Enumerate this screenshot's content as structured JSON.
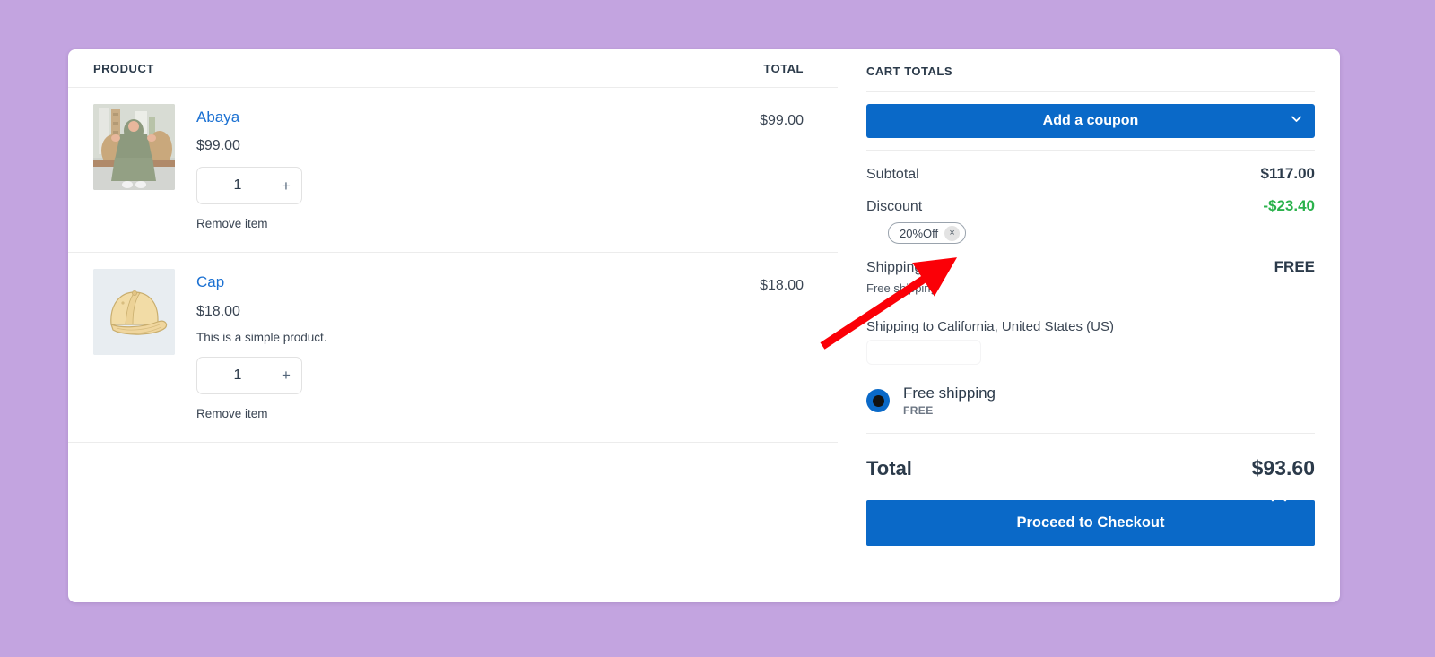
{
  "page": {
    "background_color": "#c3a4e0",
    "accent_color": "#0a69c8",
    "link_color": "#1a70d2",
    "discount_color": "#2bb24c"
  },
  "cart_table": {
    "headers": {
      "product": "PRODUCT",
      "total": "TOTAL"
    },
    "items": [
      {
        "name": "Abaya",
        "price": "$99.00",
        "description": "",
        "quantity": "1",
        "increase_label": "+",
        "remove_label": "Remove item",
        "line_total": "$99.00",
        "image": "abaya-photo"
      },
      {
        "name": "Cap",
        "price": "$18.00",
        "description": "This is a simple product.",
        "quantity": "1",
        "increase_label": "+",
        "remove_label": "Remove item",
        "line_total": "$18.00",
        "image": "cap-illustration"
      }
    ]
  },
  "cart_totals": {
    "title": "CART TOTALS",
    "coupon_button": "Add a coupon",
    "coupon_chevron_icon": "chevron-down-icon",
    "subtotal_label": "Subtotal",
    "subtotal_value": "$117.00",
    "discount_label": "Discount",
    "discount_value": "-$23.40",
    "coupon_chip": {
      "label": "20%Off",
      "remove_icon": "×"
    },
    "shipping_label": "Shipping",
    "shipping_value": "FREE",
    "shipping_note": "Free shipping",
    "shipping_address": "Shipping to California, United States (US)",
    "shipping_option": {
      "title": "Free shipping",
      "sub": "FREE",
      "selected": true
    },
    "total_label": "Total",
    "total_value": "$93.60",
    "checkout_button": "Proceed to Checkout",
    "close_icon": "chevron-up-icon"
  },
  "annotation": {
    "type": "arrow",
    "color": "#fb0007",
    "points_at": "coupon-chip"
  }
}
